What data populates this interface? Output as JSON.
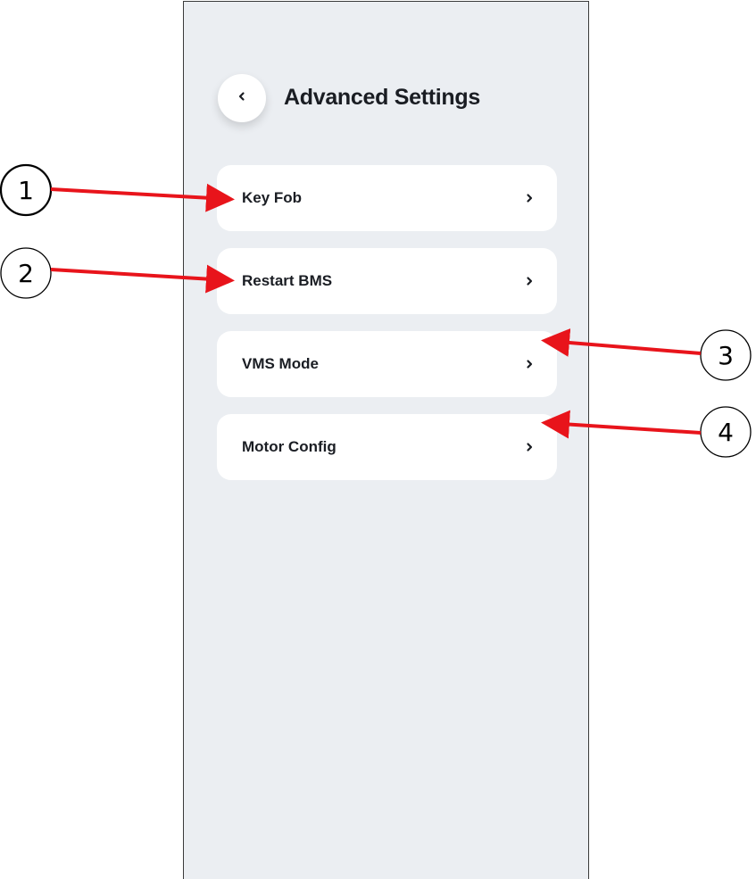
{
  "header": {
    "title": "Advanced Settings",
    "back_icon": "chevron-left-icon"
  },
  "menu": {
    "items": [
      {
        "label": "Key Fob",
        "icon": "chevron-right-icon"
      },
      {
        "label": "Restart BMS",
        "icon": "chevron-right-icon"
      },
      {
        "label": "VMS Mode",
        "icon": "chevron-right-icon"
      },
      {
        "label": "Motor Config",
        "icon": "chevron-right-icon"
      }
    ]
  },
  "annotations": {
    "callouts": [
      "1",
      "2",
      "3",
      "4"
    ],
    "arrow_color": "#e8141b"
  },
  "colors": {
    "screen_background": "#ebeef2",
    "card_background": "#ffffff",
    "text": "#1a1d23"
  }
}
